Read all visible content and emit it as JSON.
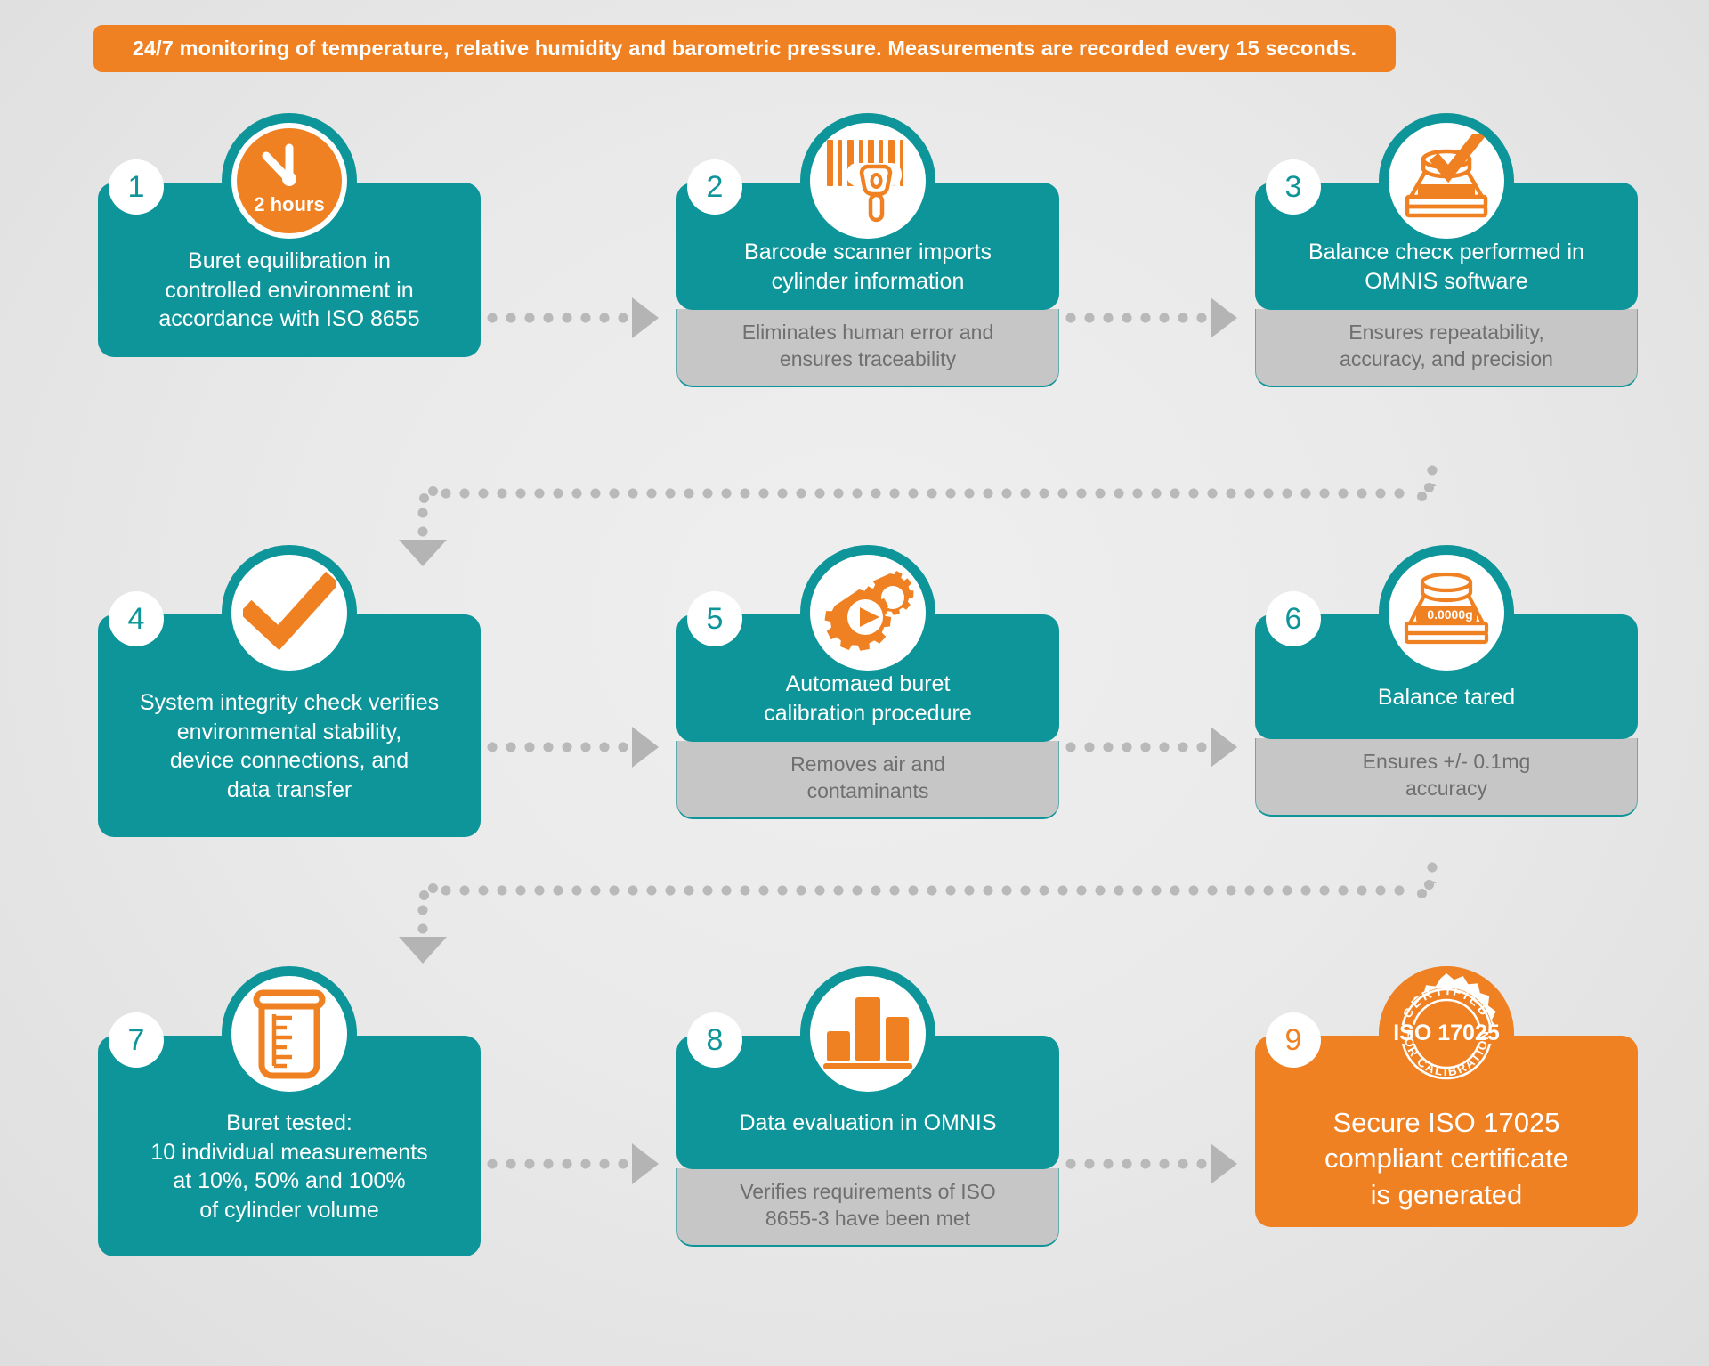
{
  "banner": {
    "text": "24/7 monitoring of temperature, relative humidity and barometric pressure. Measurements are recorded every 15 seconds.",
    "bg_color": "#F08122",
    "text_color": "#FFFFFF"
  },
  "colors": {
    "teal": "#0D9599",
    "orange": "#F08122",
    "footer_gray": "#C6C6C6",
    "footer_text": "#6F6F6F",
    "background": "#E8E8E8",
    "connector_gray": "#B9B9B9",
    "white": "#FFFFFF"
  },
  "steps": [
    {
      "number": "1",
      "title": "Buret equilibration in\ncontrolled environment in\naccordance with ISO 8655",
      "footer": null,
      "icon": "clock-icon",
      "icon_label": "2 hours",
      "accent": "teal"
    },
    {
      "number": "2",
      "title": "Barcode scanner imports\ncylinder information",
      "footer": "Eliminates human error and\nensures traceability",
      "icon": "barcode-scanner-icon",
      "icon_label": null,
      "accent": "teal"
    },
    {
      "number": "3",
      "title": "Balance check performed in\nOMNIS software",
      "footer": "Ensures repeatability,\naccuracy, and precision",
      "icon": "balance-check-icon",
      "icon_label": null,
      "accent": "teal"
    },
    {
      "number": "4",
      "title": "System integrity check verifies\nenvironmental stability,\ndevice connections, and\ndata transfer",
      "footer": null,
      "icon": "checkmark-icon",
      "icon_label": null,
      "accent": "teal"
    },
    {
      "number": "5",
      "title": "Automated buret\ncalibration procedure",
      "footer": "Removes air and\ncontaminants",
      "icon": "gears-play-icon",
      "icon_label": null,
      "accent": "teal"
    },
    {
      "number": "6",
      "title": "Balance tared",
      "footer": "Ensures +/- 0.1mg\naccuracy",
      "icon": "balance-display-icon",
      "icon_label": "0.0000g",
      "accent": "teal"
    },
    {
      "number": "7",
      "title": "Buret tested:\n10 individual measurements\nat 10%, 50% and 100%\nof cylinder volume",
      "footer": null,
      "icon": "graduated-cylinder-icon",
      "icon_label": null,
      "accent": "teal"
    },
    {
      "number": "8",
      "title": "Data evaluation in OMNIS",
      "footer": "Verifies requirements of ISO\n8655-3 have been met",
      "icon": "bar-chart-icon",
      "icon_label": null,
      "accent": "teal"
    },
    {
      "number": "9",
      "title": "Secure ISO 17025\ncompliant certificate\nis generated",
      "footer": null,
      "icon": "iso-17025-seal-icon",
      "icon_label": "CERTIFIED ISO 17025 FOR CALIBRATION",
      "accent": "orange"
    }
  ],
  "seal": {
    "top_text": "CERTIFIED",
    "center_text": "ISO 17025",
    "bottom_text": "FOR CALIBRATION"
  },
  "balance_display": {
    "reading": "0.0000g"
  },
  "clock": {
    "label": "2 hours"
  }
}
